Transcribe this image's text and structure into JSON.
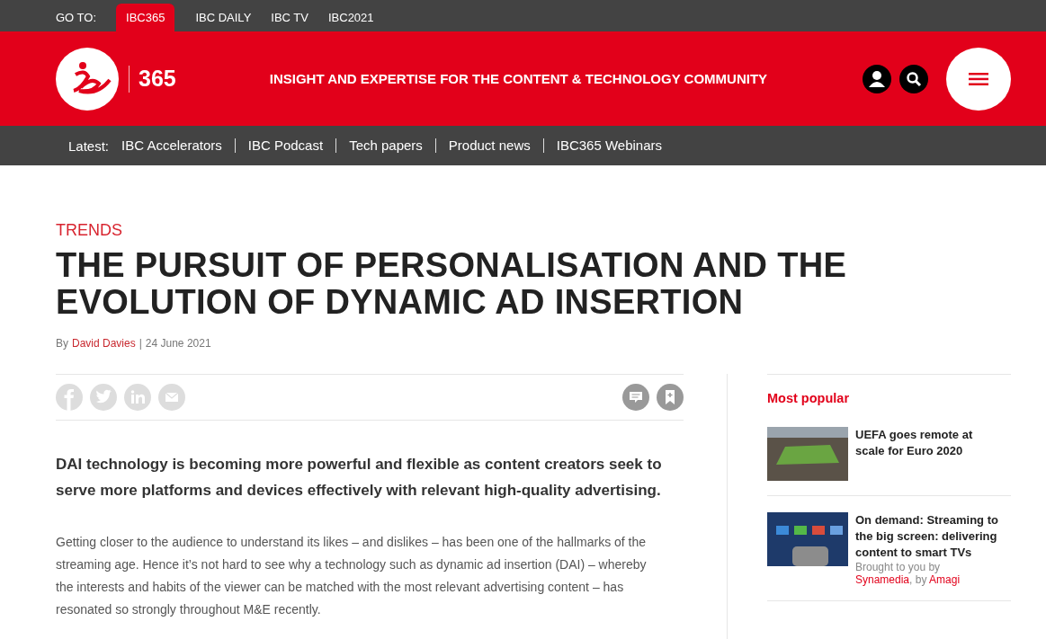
{
  "goto_bar": {
    "label": "GO TO:",
    "sites": [
      {
        "label": "IBC365",
        "selected": true
      },
      {
        "label": "IBC DAILY",
        "selected": false
      },
      {
        "label": "IBC TV",
        "selected": false
      },
      {
        "label": "IBC2021",
        "selected": false
      }
    ]
  },
  "header": {
    "logo_suffix": "365",
    "tagline": "INSIGHT AND EXPERTISE FOR THE CONTENT & TECHNOLOGY COMMUNITY"
  },
  "latest_bar": {
    "label": "Latest:",
    "links": [
      "IBC Accelerators",
      "IBC Podcast",
      "Tech papers",
      "Product news",
      "IBC365 Webinars"
    ]
  },
  "article": {
    "category": "TRENDS",
    "title": "THE PURSUIT OF PERSONALISATION AND THE EVOLUTION OF DYNAMIC AD INSERTION",
    "byline": {
      "prefix": "By",
      "author": "David Davies",
      "separator": "|",
      "date": "24 June 2021"
    },
    "standfirst": "DAI technology is becoming more powerful and flexible as content creators seek to serve more platforms and devices effectively with relevant high-quality advertising.",
    "body": "Getting closer to the audience to understand its likes – and dislikes – has been one of the hallmarks of the streaming age. Hence it’s not hard to see why a technology such as dynamic ad insertion (DAI) – whereby the interests and habits of the viewer can be matched with the most relevant advertising content – has resonated so strongly throughout M&E recently."
  },
  "sidebar": {
    "title": "Most popular",
    "items": [
      {
        "title": "UEFA goes remote at scale for Euro 2020",
        "kind": "stadium"
      },
      {
        "title": "On demand: Streaming to the big screen: delivering  content to smart TVs",
        "kind": "remote",
        "sponsor": [
          {
            "kind": "text",
            "text": "Brought to you by"
          },
          {
            "kind": "link",
            "text": "Synamedia"
          },
          {
            "kind": "text",
            "text": ", by"
          },
          {
            "kind": "link",
            "text": "Amagi"
          }
        ]
      }
    ]
  }
}
